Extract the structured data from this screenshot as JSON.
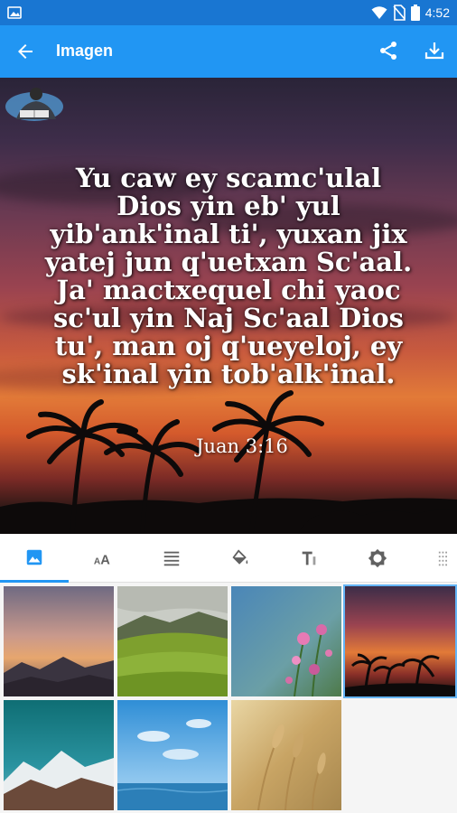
{
  "status_bar": {
    "time": "4:52",
    "icons": [
      "image-notification-icon",
      "wifi-icon",
      "no-sim-icon",
      "battery-icon"
    ]
  },
  "app_bar": {
    "title": "Imagen",
    "actions": [
      "share-icon",
      "download-icon"
    ],
    "color": "#2196f3"
  },
  "preview": {
    "verse_text": "Yu caw ey scamc'ulal\nDios yin eb' yul\nyib'ank'inal ti', yuxan jix\nyatej jun q'uetxan Sc'aal.\nJa' mactxequel chi yaoc\nsc'ul yin Naj Sc'aal Dios\ntu', man oj q'ueyeloj, ey\nsk'inal yin tob'alk'inal.",
    "reference": "Juan 3:16",
    "background": "sunset-palm-trees"
  },
  "toolbar": {
    "tools": [
      {
        "name": "image-icon",
        "active": true
      },
      {
        "name": "font-size-icon",
        "active": false
      },
      {
        "name": "align-text-icon",
        "active": false
      },
      {
        "name": "fill-color-icon",
        "active": false
      },
      {
        "name": "text-style-icon",
        "active": false
      },
      {
        "name": "brightness-icon",
        "active": false
      },
      {
        "name": "texture-icon",
        "active": false
      }
    ],
    "accent": "#2196f3"
  },
  "backgrounds": [
    {
      "name": "dusk-mountains",
      "selected": false
    },
    {
      "name": "green-valley",
      "selected": false
    },
    {
      "name": "pink-flowers",
      "selected": false
    },
    {
      "name": "sunset-palm-trees",
      "selected": true
    },
    {
      "name": "snowy-mountains",
      "selected": false
    },
    {
      "name": "ocean-sky",
      "selected": false
    },
    {
      "name": "wheat-field",
      "selected": false
    }
  ]
}
